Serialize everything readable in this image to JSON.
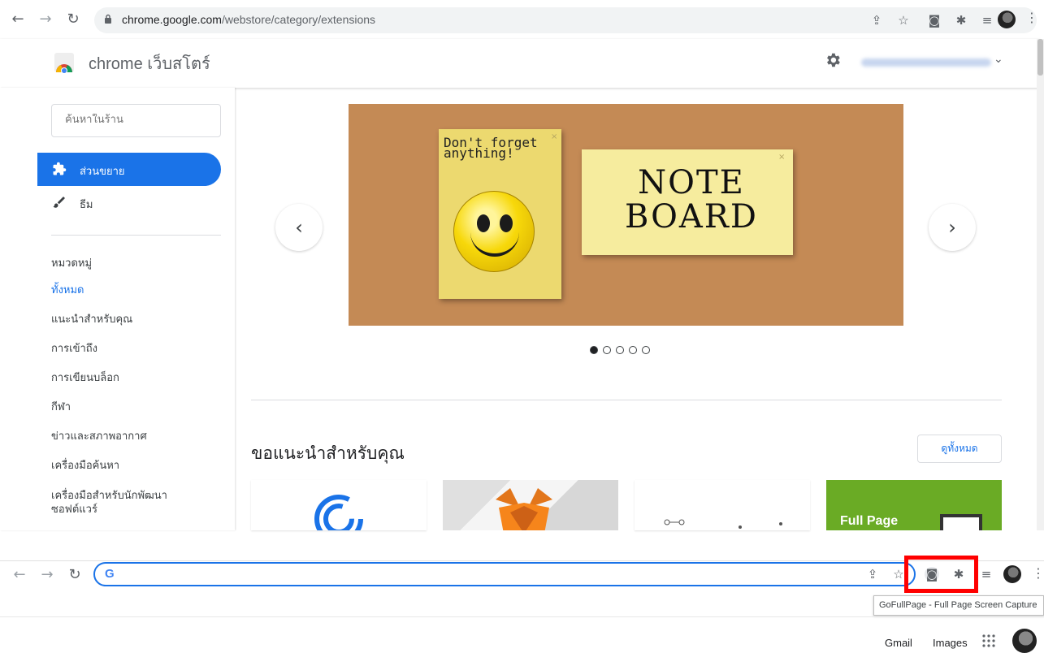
{
  "browser_top": {
    "url_host": "chrome.google.com",
    "url_path": "/webstore/category/extensions"
  },
  "store": {
    "title": "chrome เว็บสโตร์"
  },
  "sidebar": {
    "search_placeholder": "ค้นหาในร้าน",
    "nav": [
      {
        "label": "ส่วนขยาย",
        "icon": "puzzle-icon",
        "selected": true
      },
      {
        "label": "ธีม",
        "icon": "brush-icon",
        "selected": false
      }
    ],
    "categories_heading": "หมวดหมู่",
    "categories": [
      {
        "label": "ทั้งหมด",
        "active": true
      },
      {
        "label": "แนะนำสำหรับคุณ",
        "active": false
      },
      {
        "label": "การเข้าถึง",
        "active": false
      },
      {
        "label": "การเขียนบล็อก",
        "active": false
      },
      {
        "label": "กีฬา",
        "active": false
      },
      {
        "label": "ข่าวและสภาพอากาศ",
        "active": false
      },
      {
        "label": "เครื่องมือค้นหา",
        "active": false
      },
      {
        "label": "เครื่องมือสำหรับนักพัฒนาซอฟต์แวร์",
        "active": false
      }
    ]
  },
  "carousel": {
    "note1_text": "Don't forget anything!",
    "note2_text": "NOTE BOARD",
    "slide_count": 5,
    "active_slide": 1
  },
  "recommendations": {
    "title": "ขอแนะนำสำหรับคุณ",
    "see_all": "ดูทั้งหมด",
    "tile4_label": "Full Page"
  },
  "browser_bottom": {
    "search_logo": "G",
    "tooltip": "GoFullPage - Full Page Screen Capture"
  },
  "google_footer": {
    "gmail": "Gmail",
    "images": "Images"
  },
  "colors": {
    "accent": "#1a73e8",
    "highlight_box": "#ff0000",
    "cork": "#c48a55"
  }
}
